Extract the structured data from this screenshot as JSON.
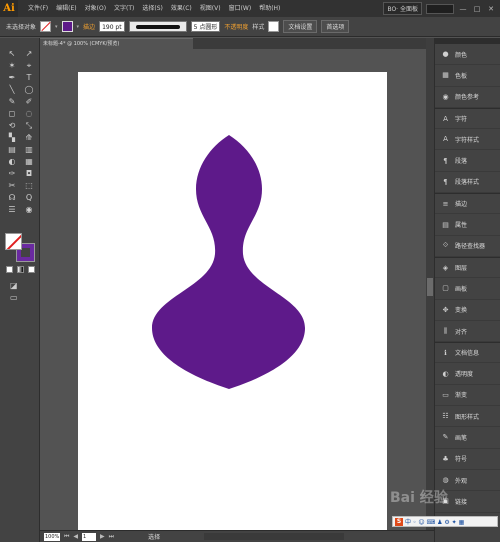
{
  "app": {
    "logo": "Ai"
  },
  "menu": [
    "文件(F)",
    "编辑(E)",
    "对象(O)",
    "文字(T)",
    "选择(S)",
    "效果(C)",
    "视图(V)",
    "窗口(W)",
    "帮助(H)"
  ],
  "workspace": "BO· 全面板",
  "window_buttons": [
    "—",
    "□",
    "✕"
  ],
  "control_bar": {
    "selection_status": "未选择对象",
    "stroke_label": "描边",
    "stroke_weight": "190 pt",
    "brush_value": "5 点圆形",
    "opacity_label": "不透明度",
    "style_label": "样式",
    "doc_setup_button": "文档设置",
    "preferences_button": "首选项"
  },
  "document_tab": "未标题-4* @ 100% (CMYK/预览)",
  "tools": [
    "↖",
    "↗",
    "✶",
    "⌖",
    "✒",
    "T",
    "╲",
    "◯",
    "✎",
    "✐",
    "◻",
    "◌",
    "⟲",
    "⤡",
    "▚",
    "⟰",
    "▤",
    "▥",
    "◐",
    "▦",
    "✑",
    "◘",
    "✂",
    "⬚",
    "☊",
    "Q",
    "☰",
    "◉"
  ],
  "status_bar": {
    "zoom": "100%",
    "page": "1",
    "status": "选择"
  },
  "panels": [
    {
      "icon": "●",
      "label": "颜色"
    },
    {
      "icon": "▦",
      "label": "色板"
    },
    {
      "icon": "◉",
      "label": "颜色参考"
    },
    {
      "icon": "A",
      "label": "字符"
    },
    {
      "icon": "A",
      "label": "字符样式"
    },
    {
      "icon": "¶",
      "label": "段落"
    },
    {
      "icon": "¶",
      "label": "段落样式"
    },
    {
      "icon": "≡",
      "label": "描边"
    },
    {
      "icon": "▤",
      "label": "属性"
    },
    {
      "icon": "⟐",
      "label": "路径查找器"
    },
    {
      "icon": "◈",
      "label": "图层"
    },
    {
      "icon": "▢",
      "label": "画板"
    },
    {
      "icon": "✥",
      "label": "变换"
    },
    {
      "icon": "⫼",
      "label": "对齐"
    },
    {
      "icon": "ℹ",
      "label": "文档信息"
    },
    {
      "icon": "◐",
      "label": "透明度"
    },
    {
      "icon": "▭",
      "label": "渐变"
    },
    {
      "icon": "☷",
      "label": "图形样式"
    },
    {
      "icon": "✎",
      "label": "画笔"
    },
    {
      "icon": "♣",
      "label": "符号"
    },
    {
      "icon": "◍",
      "label": "外观"
    },
    {
      "icon": "▣",
      "label": "链接"
    }
  ],
  "watermark": "Bai 经验",
  "ime": {
    "logo": "S",
    "items": "中 ◦ ☺ ⌨ ♟ ⚙ ✦ ▦"
  },
  "colors": {
    "shape_fill": "#5e1a8a",
    "accent_orange": "#f0a030"
  }
}
